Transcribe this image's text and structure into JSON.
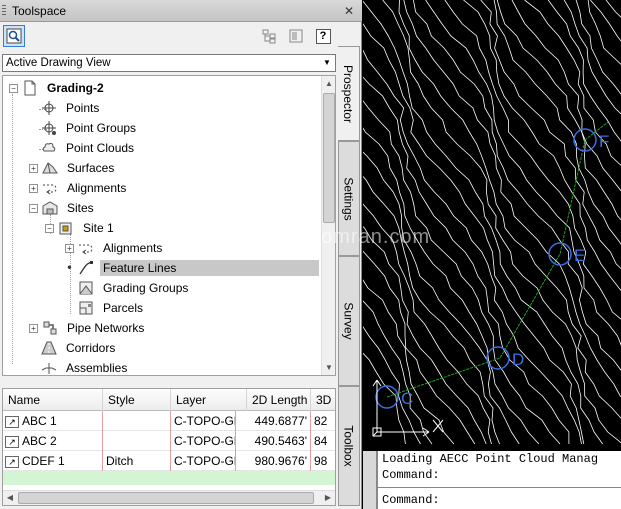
{
  "toolspace": {
    "title": "Toolspace",
    "close": "✕",
    "view_dropdown": {
      "value": "Active Drawing View"
    },
    "toolbar": {
      "help": "?"
    },
    "tabs": [
      "Prospector",
      "Settings",
      "Survey",
      "Toolbox"
    ],
    "tree": {
      "root": "Grading-2",
      "items": {
        "points": "Points",
        "point_groups": "Point Groups",
        "point_clouds": "Point Clouds",
        "surfaces": "Surfaces",
        "alignments": "Alignments",
        "sites": "Sites",
        "site1": "Site 1",
        "site_alignments": "Alignments",
        "feature_lines": "Feature Lines",
        "grading_groups": "Grading Groups",
        "parcels": "Parcels",
        "pipe_networks": "Pipe Networks",
        "corridors": "Corridors",
        "assemblies": "Assemblies"
      }
    },
    "grid": {
      "columns": [
        "Name",
        "Style",
        "Layer",
        "2D Length",
        "3D"
      ],
      "rows": [
        {
          "name": "ABC 1",
          "style": "",
          "layer": "C-TOPO-GF",
          "len2d": "449.6877'",
          "len3d": "82"
        },
        {
          "name": "ABC 2",
          "style": "",
          "layer": "C-TOPO-GF",
          "len2d": "490.5463'",
          "len3d": "84"
        },
        {
          "name": "CDEF 1",
          "style": "Ditch",
          "layer": "C-TOPO-GF",
          "len2d": "980.9676'",
          "len3d": "98"
        }
      ]
    }
  },
  "drawing": {
    "labels": [
      "C",
      "D",
      "E",
      "F"
    ],
    "colors": {
      "background": "#000000",
      "contours": "#ffffff",
      "markers": "#3a6fe0",
      "feature_line": "#1fa21f"
    }
  },
  "command_line": {
    "history": "Loading AECC Point Cloud Manag",
    "prompt1": "Command:",
    "prompt2": "Command:"
  },
  "watermark": "www.omran-omran.com"
}
